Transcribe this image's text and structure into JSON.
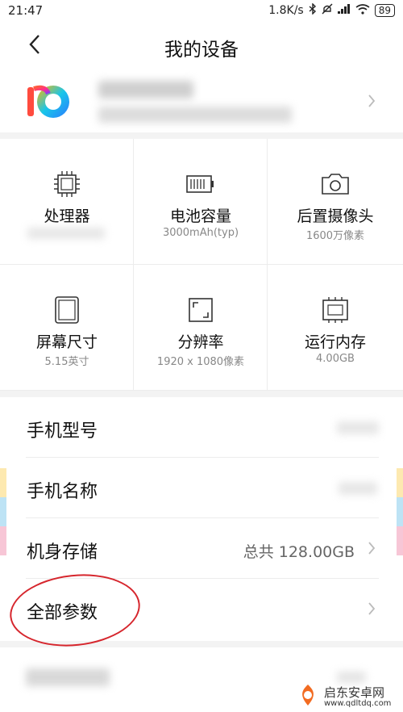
{
  "status_bar": {
    "time": "21:47",
    "speed": "1.8K/s",
    "battery": "89"
  },
  "header": {
    "title": "我的设备"
  },
  "specs": [
    {
      "label": "处理器",
      "value": "",
      "icon": "cpu-icon"
    },
    {
      "label": "电池容量",
      "value": "3000mAh(typ)",
      "icon": "battery-icon"
    },
    {
      "label": "后置摄像头",
      "value": "1600万像素",
      "icon": "camera-icon"
    },
    {
      "label": "屏幕尺寸",
      "value": "5.15英寸",
      "icon": "screen-icon"
    },
    {
      "label": "分辨率",
      "value": "1920 x 1080像素",
      "icon": "resolution-icon"
    },
    {
      "label": "运行内存",
      "value": "4.00GB",
      "icon": "ram-icon"
    }
  ],
  "list": [
    {
      "label": "手机型号",
      "value": ""
    },
    {
      "label": "手机名称",
      "value": ""
    },
    {
      "label": "机身存储",
      "value": "总共 128.00GB"
    },
    {
      "label": "全部参数",
      "value": ""
    }
  ],
  "watermark": {
    "name": "启东安卓网",
    "url": "www.qdltdq.com"
  },
  "colors": {
    "accent_red": "#d6262d",
    "divider": "#ececec"
  }
}
